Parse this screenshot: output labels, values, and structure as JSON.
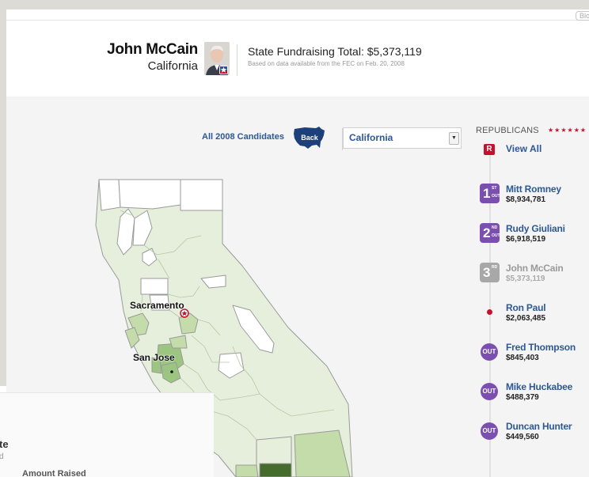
{
  "window": {
    "blog_button": "Blo"
  },
  "header": {
    "candidate_name": "John McCain",
    "state": "California",
    "total_text": "State Fundraising Total: $5,373,119",
    "source_text": "Based on data available from the FEC on Feb. 20, 2008"
  },
  "toolbar": {
    "all_candidates": "All 2008 Candidates",
    "back_label": "Back",
    "state_select": {
      "selected": "California",
      "arrow": "▼"
    }
  },
  "map": {
    "cities": [
      {
        "name": "Sacramento"
      },
      {
        "name": "San Jose"
      }
    ],
    "colors": {
      "light": "#e6efdc",
      "medium": "#c3dca9",
      "strong": "#9bc580",
      "dark": "#456c2c",
      "empty": "#ffffff",
      "border": "#9a9a9a"
    }
  },
  "sidebar": {
    "title": "REPUBLICANS",
    "stars": "★★★★★★",
    "r_icon": "R",
    "view_all": "View All",
    "candidates": [
      {
        "rank": "1",
        "sup": "ST",
        "sub": "OUT",
        "name": "Mitt Romney",
        "amount": "$8,934,781",
        "marker": "rank-badge",
        "color": "#7a4fb0"
      },
      {
        "rank": "2",
        "sup": "ND",
        "sub": "OUT",
        "name": "Rudy Giuliani",
        "amount": "$6,918,519",
        "marker": "rank-badge",
        "color": "#7a4fb0"
      },
      {
        "rank": "3",
        "sup": "RD",
        "sub": "",
        "name": "John McCain",
        "amount": "$5,373,119",
        "marker": "rank-badge",
        "color": "#a8a8a8"
      },
      {
        "name": "Ron Paul",
        "amount": "$2,063,485",
        "marker": "red-dot"
      },
      {
        "out": "OUT",
        "name": "Fred Thompson",
        "amount": "$845,403",
        "marker": "out-circle"
      },
      {
        "out": "OUT",
        "name": "Mike Huckabee",
        "amount": "$488,379",
        "marker": "out-circle"
      },
      {
        "out": "OUT",
        "name": "Duncan Hunter",
        "amount": "$449,560",
        "marker": "out-circle"
      }
    ]
  },
  "background_window": {
    "cut_heading": "te",
    "cut_sub": "d",
    "amount_raised": "Amount Raised"
  }
}
